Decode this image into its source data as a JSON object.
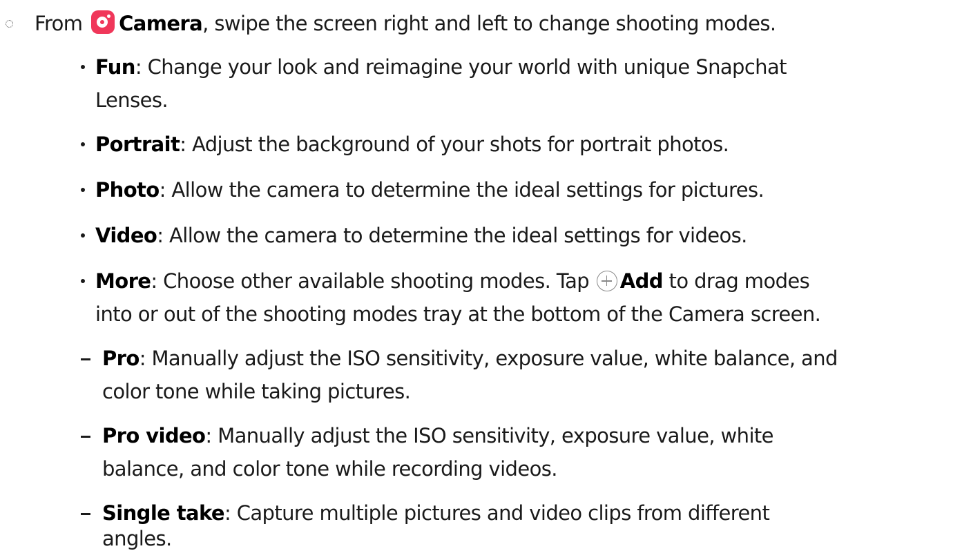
{
  "intro": {
    "prefix": "From",
    "app": "Camera",
    "rest": ", swipe the screen right and left to change shooting modes."
  },
  "modes": [
    {
      "term": "Fun",
      "line1": ": Change your look and reimagine your world with unique Snapchat",
      "line2": "Lenses."
    },
    {
      "term": "Portrait",
      "line1": ": Adjust the background of your shots for portrait photos."
    },
    {
      "term": "Photo",
      "line1": ": Allow the camera to determine the ideal settings for pictures."
    },
    {
      "term": "Video",
      "line1": ": Allow the camera to determine the ideal settings for videos."
    },
    {
      "term": "More",
      "line1": ": Choose other available shooting modes. Tap",
      "add_label": "Add",
      "line1_end": "to drag modes",
      "line2": "into or out of the shooting modes tray at the bottom of the Camera screen."
    }
  ],
  "submodes": [
    {
      "term": "Pro",
      "line1": ": Manually adjust the ISO sensitivity, exposure value, white balance, and",
      "line2": "color tone while taking pictures."
    },
    {
      "term": "Pro video",
      "line1": ": Manually adjust the ISO sensitivity, exposure value, white",
      "line2": "balance, and color tone while recording videos."
    },
    {
      "term": "Single take",
      "line1": ": Capture multiple pictures and video clips from different",
      "line2": "angles."
    }
  ],
  "icons": {
    "camera": "camera-app-icon",
    "add": "add-circle-icon",
    "camera_color": "#f0375a"
  }
}
